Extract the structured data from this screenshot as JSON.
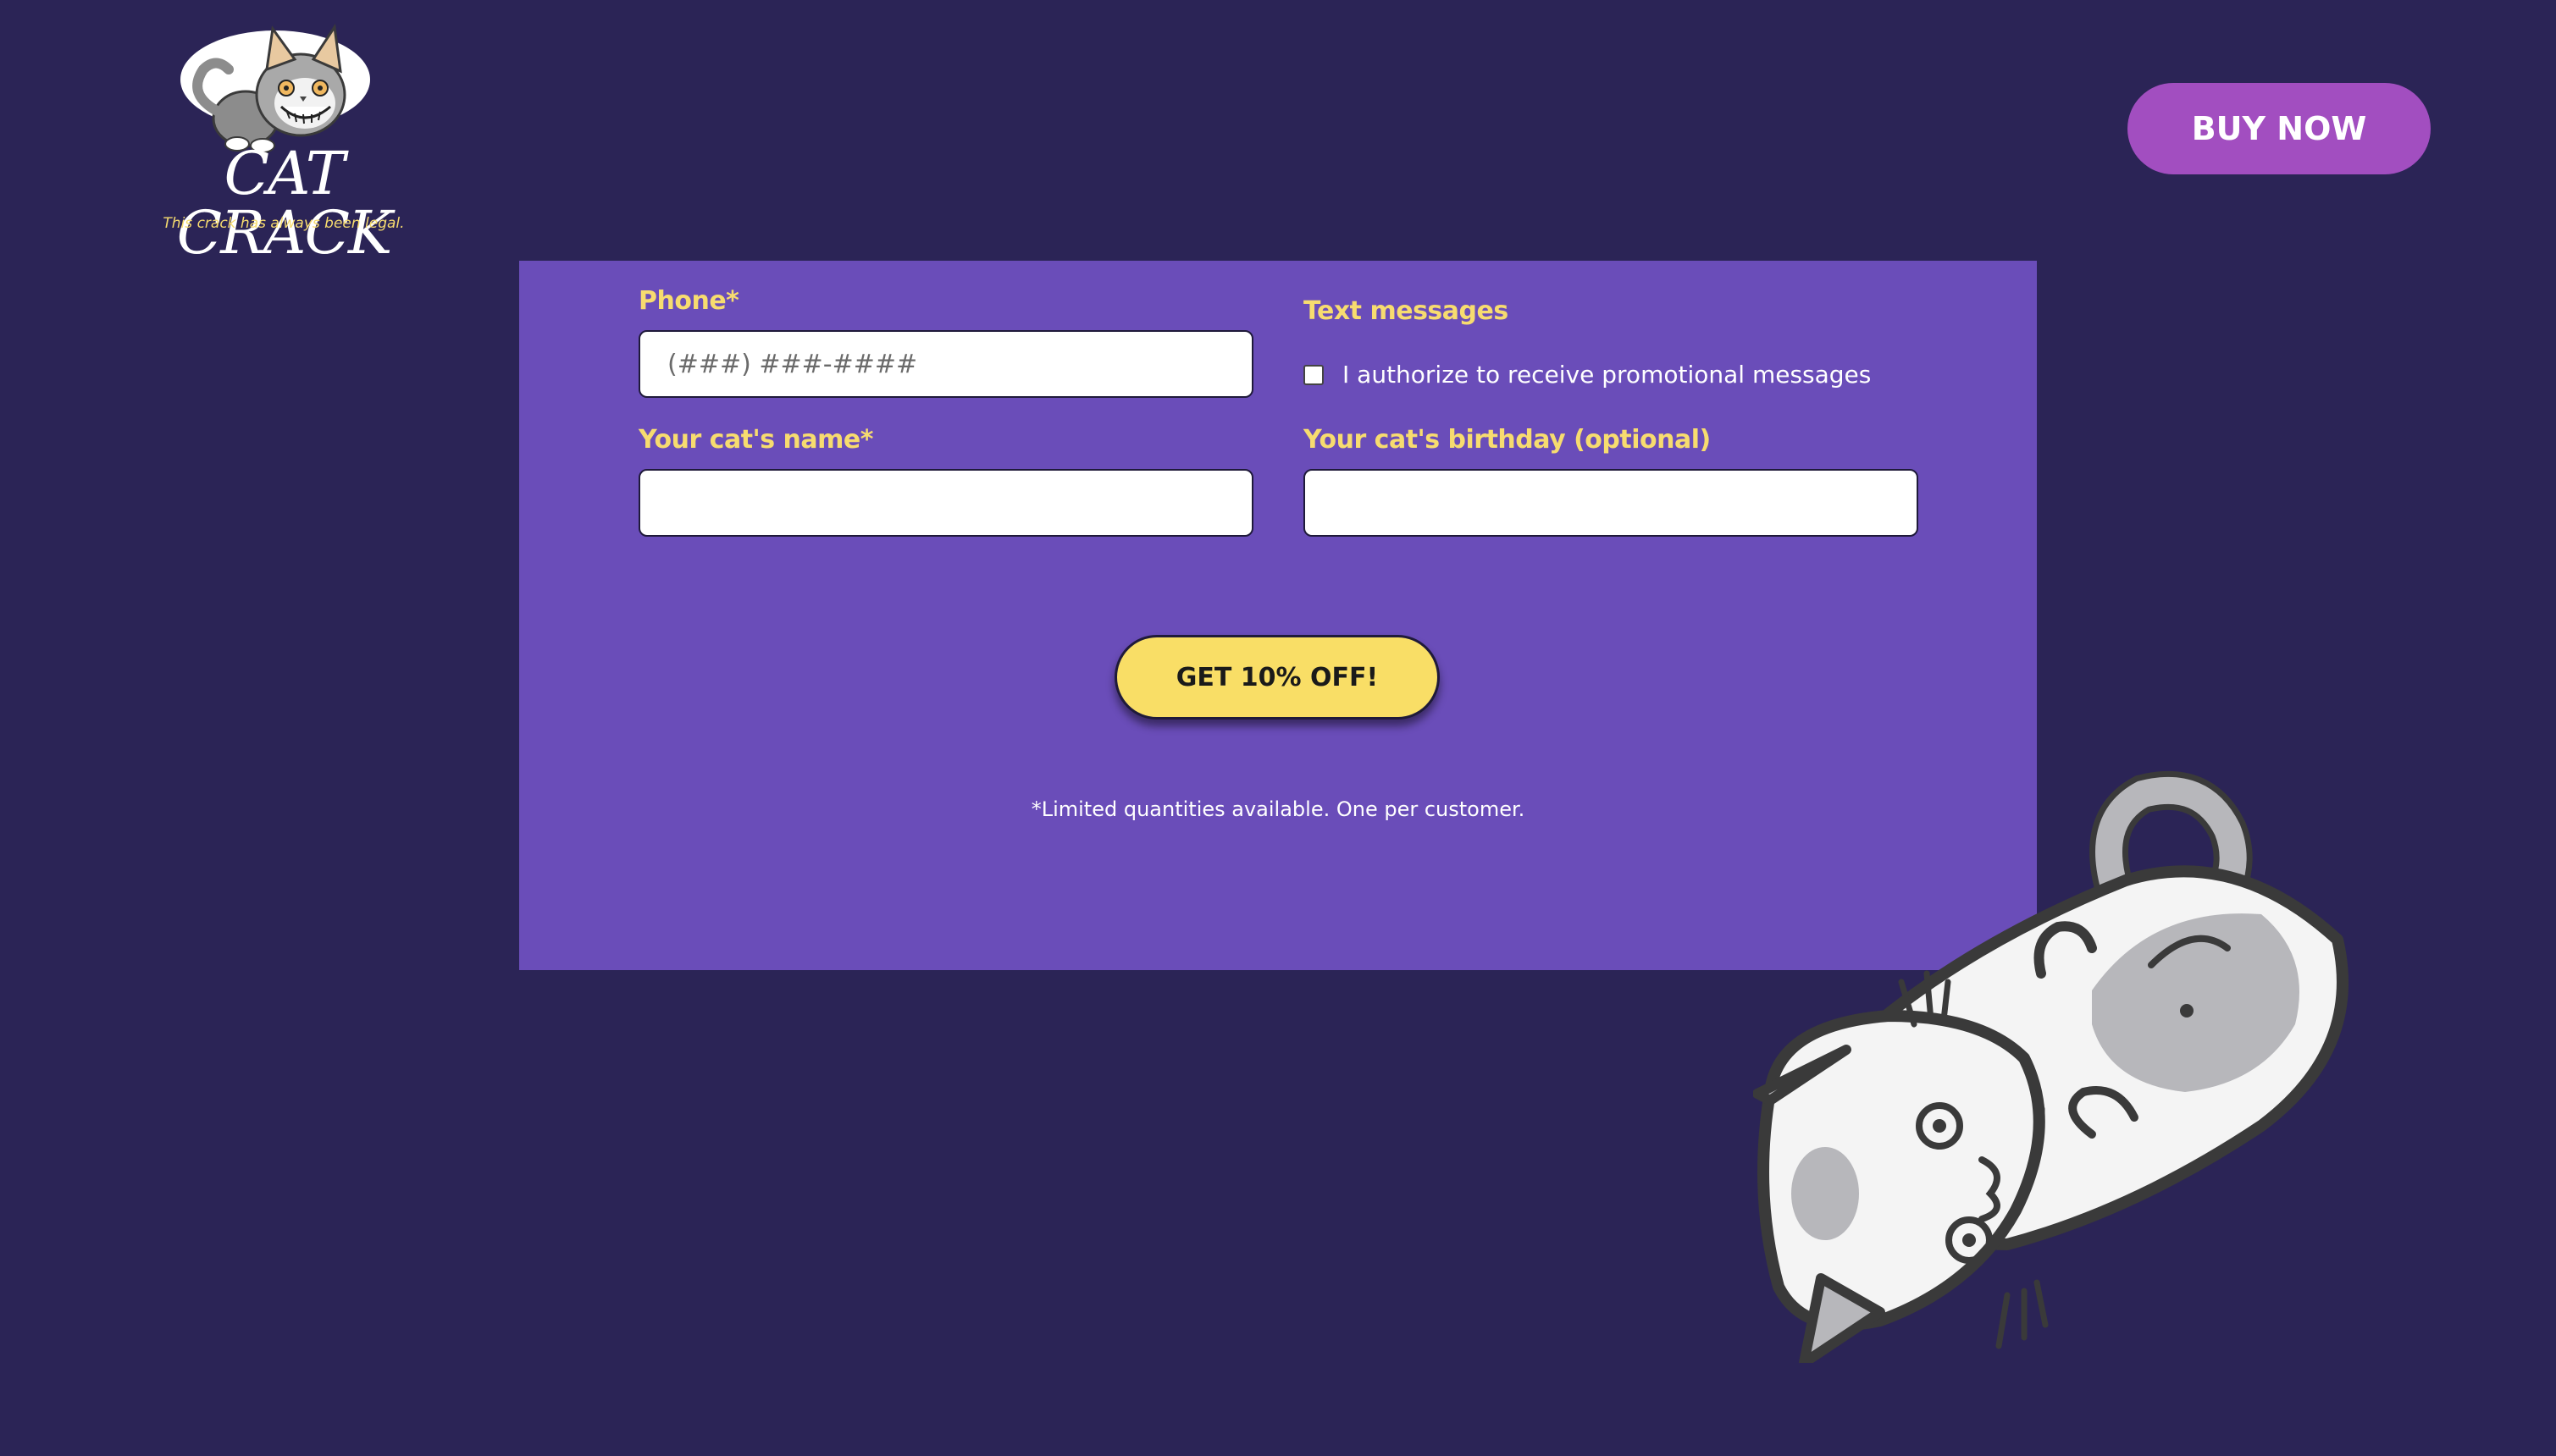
{
  "brand": {
    "name": "CAT CRACK",
    "tagline": "This crack has always been legal."
  },
  "header": {
    "buy_now_label": "BUY NOW"
  },
  "form": {
    "phone": {
      "label": "Phone*",
      "placeholder": "(###) ###-####",
      "value": ""
    },
    "text_messages": {
      "label": "Text messages",
      "checkbox_label": "I authorize to receive promotional messages",
      "checked": false
    },
    "cat_name": {
      "label": "Your cat's name*",
      "value": ""
    },
    "cat_birthday": {
      "label": "Your cat's birthday (optional)",
      "value": ""
    },
    "submit_label": "GET 10% OFF!",
    "disclaimer": "*Limited quantities available. One per customer."
  },
  "colors": {
    "background": "#2b2456",
    "panel": "#6a4db9",
    "label": "#f7dc6f",
    "buy_now": "#a24ec0",
    "submit": "#f9de66"
  },
  "icons": {
    "logo": "cat-mascot-logo",
    "illustration": "upside-down-cat-illustration"
  }
}
